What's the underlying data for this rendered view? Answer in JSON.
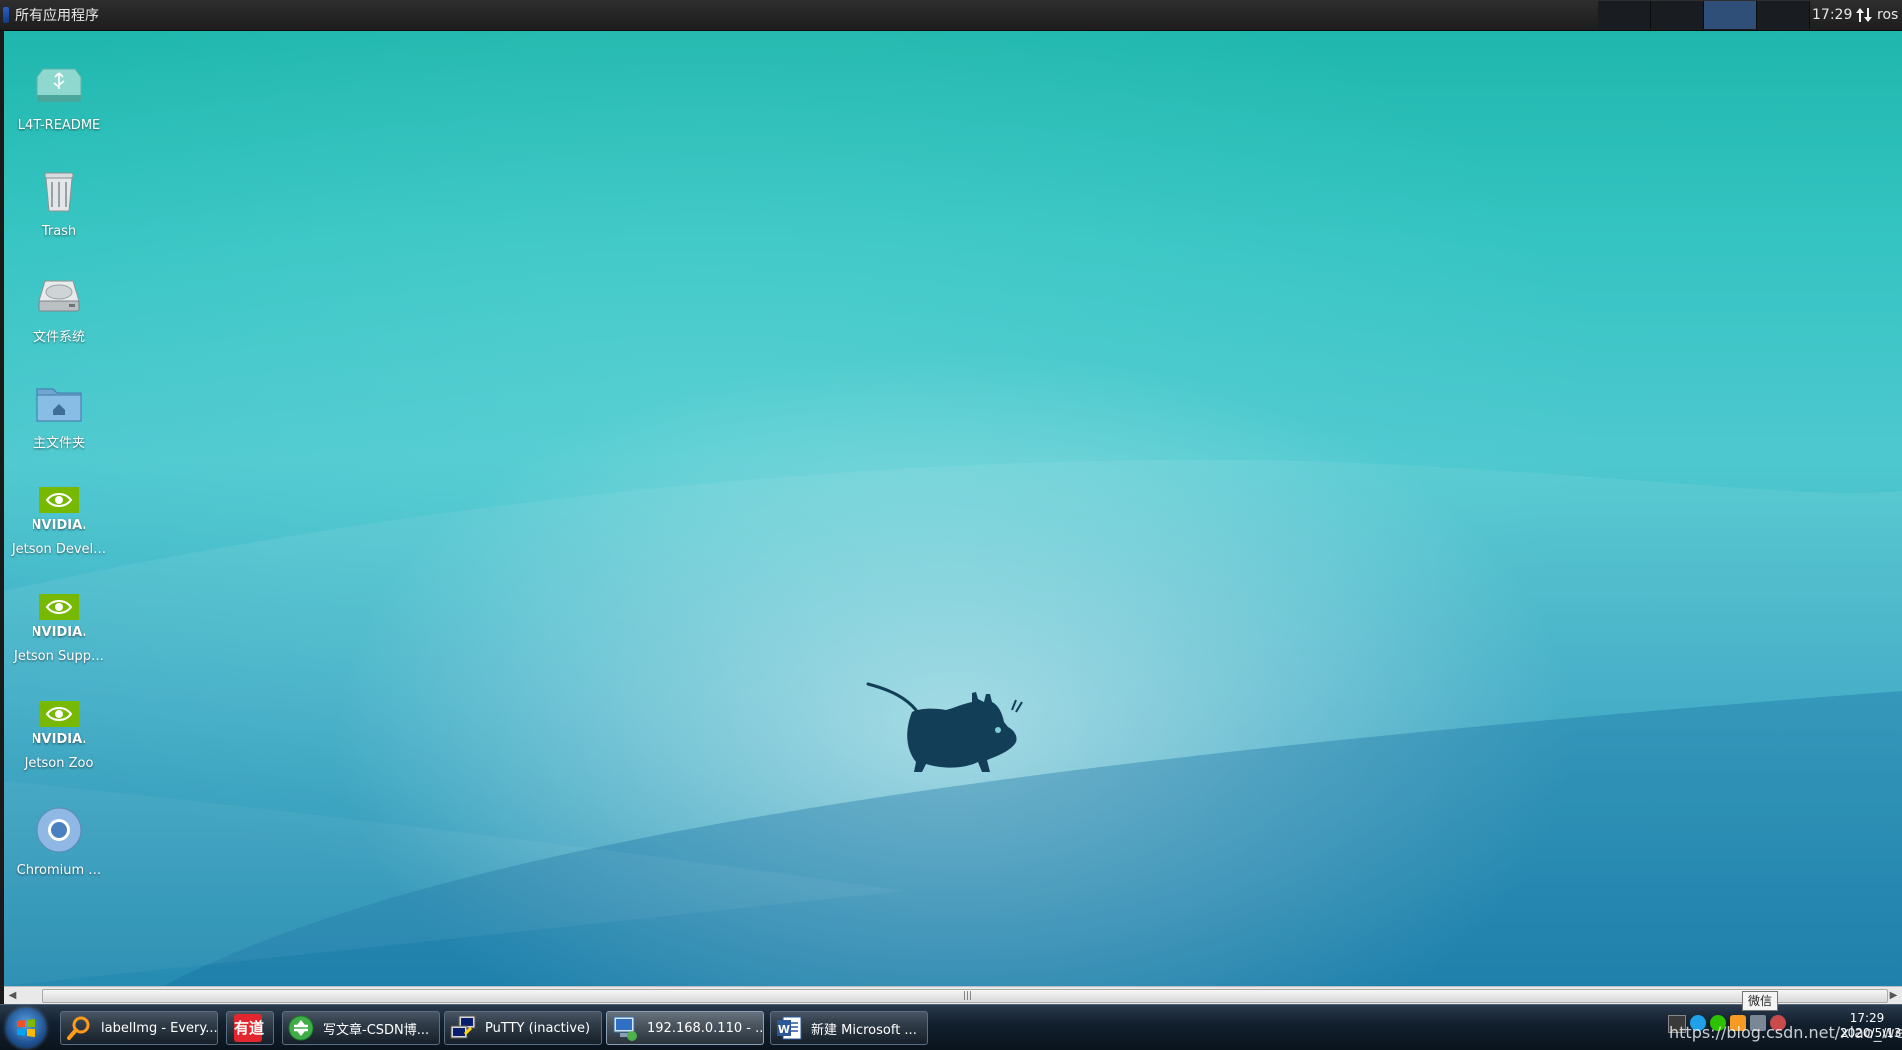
{
  "top_panel": {
    "apps_menu_label": "所有应用程序",
    "clock": "17:29",
    "user": "ros",
    "workspaces": 4,
    "active_workspace": 3
  },
  "desktop_icons": [
    {
      "label": "L4T-README",
      "icon": "usb-drive-icon"
    },
    {
      "label": "Trash",
      "icon": "trash-icon"
    },
    {
      "label": "文件系统",
      "icon": "hard-drive-icon"
    },
    {
      "label": "主文件夹",
      "icon": "home-folder-icon"
    },
    {
      "label": "Jetson Devel…",
      "icon": "nvidia-icon"
    },
    {
      "label": "Jetson Supp…",
      "icon": "nvidia-icon"
    },
    {
      "label": "Jetson Zoo",
      "icon": "nvidia-icon"
    },
    {
      "label": "Chromium …",
      "icon": "chromium-icon"
    }
  ],
  "taskbar": {
    "buttons": [
      {
        "label": "labelImg - Every...",
        "icon": "search-icon"
      },
      {
        "label": "有道",
        "icon": "youdao-icon"
      },
      {
        "label": "写文章-CSDN博...",
        "icon": "browser-icon"
      },
      {
        "label": "PuTTY (inactive)",
        "icon": "putty-icon"
      },
      {
        "label": "192.168.0.110 - ...",
        "icon": "remote-desktop-icon"
      },
      {
        "label": "新建 Microsoft ...",
        "icon": "word-icon"
      }
    ],
    "tray_url": "https://blog.csdn.net/xiao_wen",
    "time": "17:29",
    "date": "2020/5/13",
    "tooltip": "微信"
  },
  "colors": {
    "desktop_top": "#1fb7ad",
    "desktop_bottom": "#1583ac",
    "mouse": "#123f57",
    "workspace_active": "#2f4f78",
    "nvidia_green": "#76b900"
  }
}
